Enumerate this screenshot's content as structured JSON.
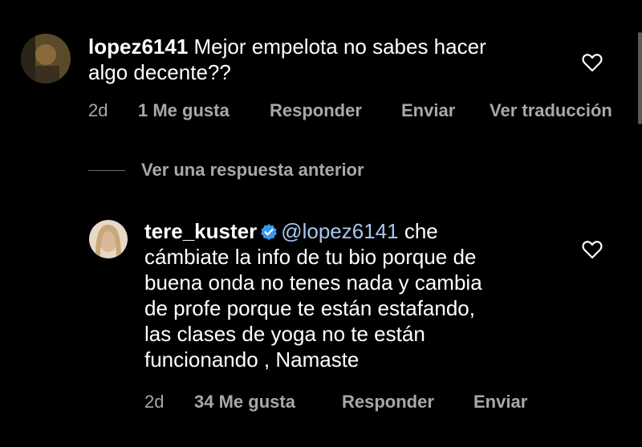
{
  "comments": [
    {
      "username": "lopez6141",
      "text_line1": " Mejor empelota no sabes hacer",
      "text_line2": "algo decente??",
      "time": "2d",
      "likes": "1 Me gusta",
      "reply": "Responder",
      "send": "Enviar",
      "translate": "Ver traducción"
    },
    {
      "username": "tere_kuster",
      "mention": "@lopez6141",
      "text_line1": " che",
      "text_lines": [
        "cámbiate la info de tu bio porque de",
        "buena onda no tenes nada y cambia",
        "de profe porque te están estafando,",
        "las clases de yoga no te están",
        "funcionando , Namaste"
      ],
      "time": "2d",
      "likes": "34 Me gusta",
      "reply": "Responder",
      "send": "Enviar"
    }
  ],
  "view_previous_reply": "Ver una respuesta anterior",
  "colors": {
    "background": "#000000",
    "secondary": "#a8a8a8",
    "mention": "#a8c6ef",
    "verified": "#3897f0"
  }
}
